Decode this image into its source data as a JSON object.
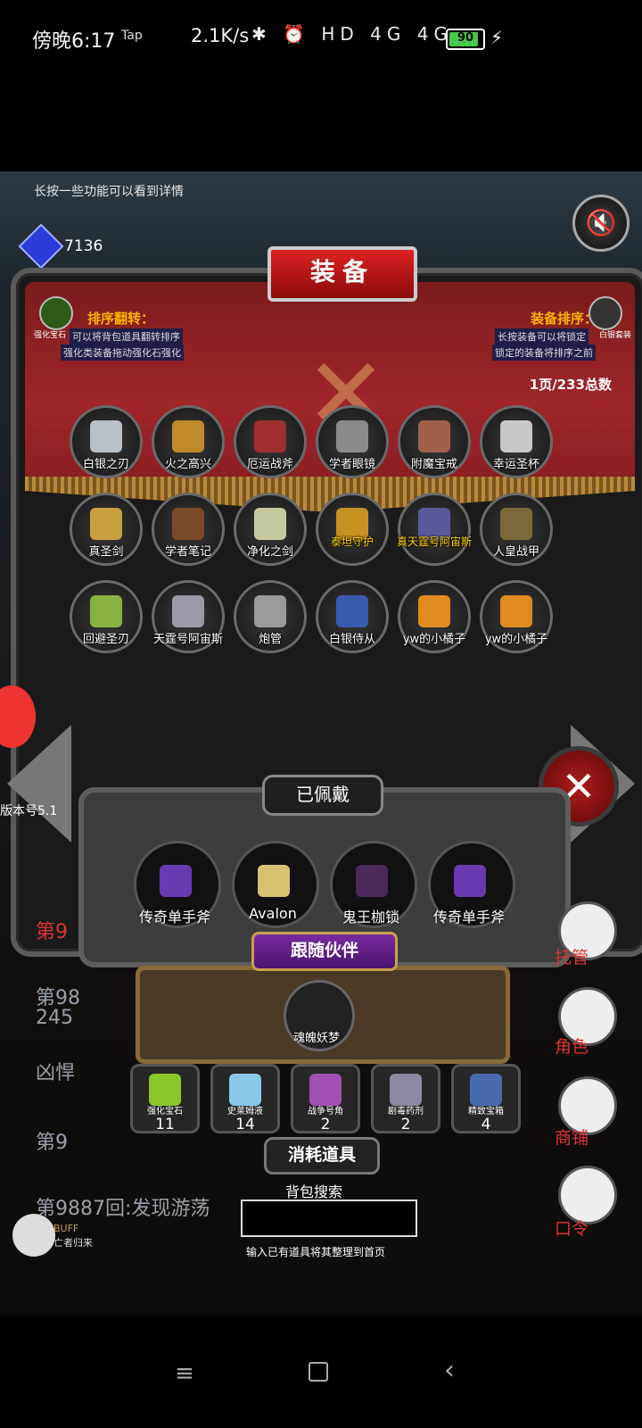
{
  "status_bar": {
    "time": "傍晚6:17",
    "tap": "Tap",
    "speed": "2.1K/s",
    "icons": "✱ ⏰ HD 4G 4G",
    "battery": "90",
    "battery_level": 0.9,
    "charging_icon": "bolt-icon"
  },
  "game": {
    "hint": "长按一些功能可以看到详情",
    "gem_value": "7136",
    "gem_label": "宝石",
    "title": "装备",
    "left_badge_label": "强化宝石",
    "right_badge_label": "白银套装",
    "sort_flip": {
      "title": "排序翻转：",
      "line1": "可以将背包道具翻转排序",
      "line2": "强化类装备拖动强化石强化"
    },
    "sort_equip": {
      "title": "装备排序：",
      "line1": "长按装备可以将锁定",
      "line2": "锁定的装备将排序之前"
    },
    "page_info": "1页/233总数",
    "items": [
      {
        "label": "白银之刃",
        "color": "#b8c0c8",
        "gold": false
      },
      {
        "label": "火之高兴",
        "color": "#c08a2a",
        "gold": false
      },
      {
        "label": "厄运战斧",
        "color": "#a03030",
        "gold": false
      },
      {
        "label": "学者眼镜",
        "color": "#8a8a8a",
        "gold": false
      },
      {
        "label": "附魔宝戒",
        "color": "#a0604a",
        "gold": false
      },
      {
        "label": "幸运圣杯",
        "color": "#c8c8c8",
        "gold": false
      },
      {
        "label": "真圣剑",
        "color": "#c8a040",
        "gold": false
      },
      {
        "label": "学者笔记",
        "color": "#7a4a2a",
        "gold": false
      },
      {
        "label": "净化之剑",
        "color": "#c8c8a0",
        "gold": false
      },
      {
        "label": "泰坦守护",
        "color": "#c89020",
        "gold": true
      },
      {
        "label": "真天霆号阿宙斯",
        "color": "#5a5a9a",
        "gold": true
      },
      {
        "label": "人皇战甲",
        "color": "#7a6a3a",
        "gold": false
      },
      {
        "label": "回避圣刃",
        "color": "#8ab040",
        "gold": false
      },
      {
        "label": "天霆号阿宙斯",
        "color": "#9a9aa8",
        "gold": false
      },
      {
        "label": "炮管",
        "color": "#9a9a9a",
        "gold": false
      },
      {
        "label": "白银侍从",
        "color": "#3a5ab0",
        "gold": false
      },
      {
        "label": "yw的小橘子",
        "color": "#e08a20",
        "gold": false
      },
      {
        "label": "yw的小橘子",
        "color": "#e08a20",
        "gold": false
      }
    ],
    "version": "版本号5.1",
    "log_red": "第9",
    "log_lines": [
      "第98",
      "245",
      "凶悍",
      "第9",
      "第9887回:发现游荡"
    ],
    "equipped": {
      "title": "已佩戴",
      "items": [
        {
          "label": "传奇单手斧",
          "color": "#6a3ab0"
        },
        {
          "label": "Avalon",
          "color": "#d8c070"
        },
        {
          "label": "鬼王枷锁",
          "color": "#4a2a5a"
        },
        {
          "label": "传奇单手斧",
          "color": "#6a3ab0"
        }
      ]
    },
    "companion": {
      "title": "跟随伙伴",
      "name": "魂魄妖梦"
    },
    "consumables": {
      "title": "消耗道具",
      "items": [
        {
          "name": "强化宝石",
          "count": "11",
          "color": "#8ac82a"
        },
        {
          "name": "史莱姆液",
          "count": "14",
          "color": "#8ac8e8"
        },
        {
          "name": "战争号角",
          "count": "2",
          "color": "#a050b0"
        },
        {
          "name": "剧毒药剂",
          "count": "2",
          "color": "#8a8aa0"
        },
        {
          "name": "精致宝箱",
          "count": "4",
          "color": "#4a6ab0"
        }
      ]
    },
    "search": {
      "label": "背包搜索",
      "value": "",
      "hint": "输入已有道具将其整理到首页"
    },
    "side_buttons": [
      "托管",
      "角色",
      "商铺",
      "口令"
    ],
    "buff": {
      "label": "BUFF",
      "sub": "亡者归来"
    },
    "close_icon": "close-icon",
    "mute_icon": "volume-mute-icon"
  },
  "nav": {
    "menu_icon": "menu-icon",
    "home_icon": "home-icon",
    "back_icon": "back-icon"
  }
}
